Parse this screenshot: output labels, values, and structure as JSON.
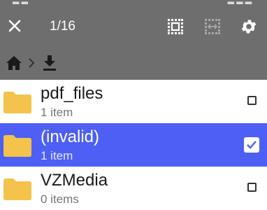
{
  "toolbar": {
    "counter": "1/16",
    "close_icon": "close-icon",
    "select_all_icon": "select-all-icon",
    "select_range_icon": "select-range-icon",
    "settings_icon": "gear-icon"
  },
  "breadcrumb": {
    "home_icon": "home-icon",
    "separator_icon": "chevron-right-icon",
    "current_icon": "download-icon"
  },
  "files": [
    {
      "name": "pdf_files",
      "meta": "1 item",
      "selected": false
    },
    {
      "name": "(invalid)",
      "meta": "1 item",
      "selected": true
    },
    {
      "name": "VZMedia",
      "meta": "0 items",
      "selected": false
    }
  ],
  "colors": {
    "toolbar": "#6e6e6e",
    "selection": "#4d5ff5",
    "folder": "#f3c34c"
  }
}
